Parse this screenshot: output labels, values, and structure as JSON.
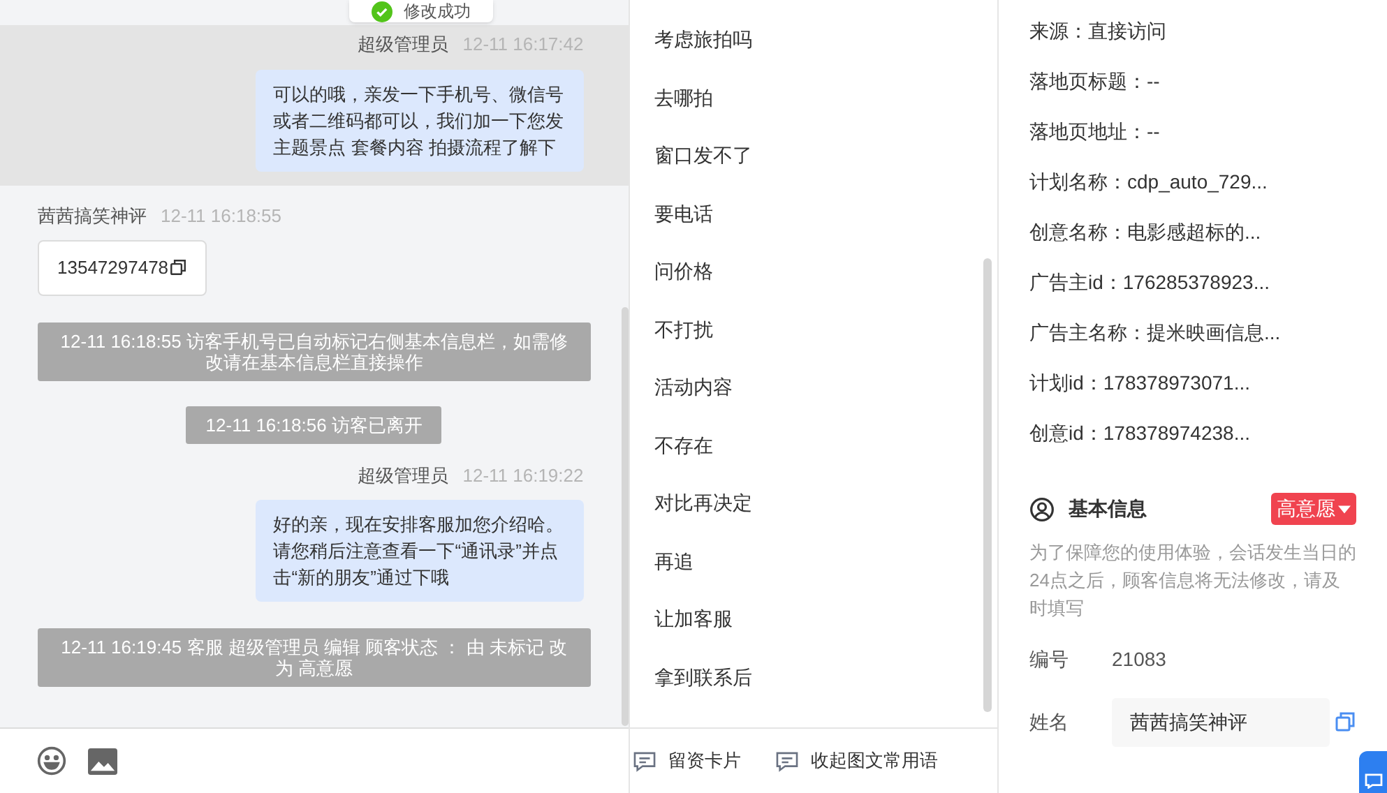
{
  "toast": {
    "text": "修改成功"
  },
  "messages": [
    {
      "kind": "agent",
      "sender": "超级管理员",
      "time": "12-11 16:17:42",
      "text": "可以的哦，亲发一下手机号、微信号或者二维码都可以，我们加一下您发主题景点 套餐内容 拍摄流程了解下",
      "highlighted": true
    },
    {
      "kind": "visitor",
      "sender": "茜茜搞笑神评",
      "time": "12-11 16:18:55",
      "text": "13547297478",
      "highlighted": false
    },
    {
      "kind": "system",
      "text": "12-11 16:18:55 访客手机号已自动标记右侧基本信息栏，如需修改请在基本信息栏直接操作",
      "highlighted": false
    },
    {
      "kind": "system",
      "text": "12-11 16:18:56 访客已离开",
      "highlighted": false
    },
    {
      "kind": "agent",
      "sender": "超级管理员",
      "time": "12-11 16:19:22",
      "text": "好的亲，现在安排客服加您介绍哈。请您稍后注意查看一下“通讯录”并点击“新的朋友”通过下哦",
      "highlighted": false
    },
    {
      "kind": "system",
      "text": "12-11 16:19:45 客服 超级管理员 编辑 顾客状态 ： 由 未标记 改为 高意愿",
      "highlighted": false
    }
  ],
  "quick_replies": [
    "考虑旅拍吗",
    "去哪拍",
    "窗口发不了",
    "要电话",
    "问价格",
    "不打扰",
    "活动内容",
    "不存在",
    "对比再决定",
    "再追",
    "让加客服",
    "拿到联系后"
  ],
  "quick_actions": [
    "留资卡片",
    "收起图文常用语"
  ],
  "source_info": [
    "来源：直接访问",
    "落地页标题：--",
    "落地页地址：--",
    "计划名称：cdp_auto_729...",
    "创意名称：电影感超标的...",
    "广告主id：176285378923...",
    "广告主名称：提米映画信息...",
    "计划id：178378973071...",
    "创意id：178378974238..."
  ],
  "basic_info": {
    "title": "基本信息",
    "status": {
      "label": "高意愿",
      "color": "#f0434f"
    },
    "notice": "为了保障您的使用体验，会话发生当日的24点之后，顾客信息将无法修改，请及时填写",
    "fields": [
      {
        "kind": "text",
        "label": "编号",
        "value": "21083"
      },
      {
        "kind": "input",
        "label": "姓名",
        "value": "茜茜搞笑神评"
      }
    ]
  }
}
